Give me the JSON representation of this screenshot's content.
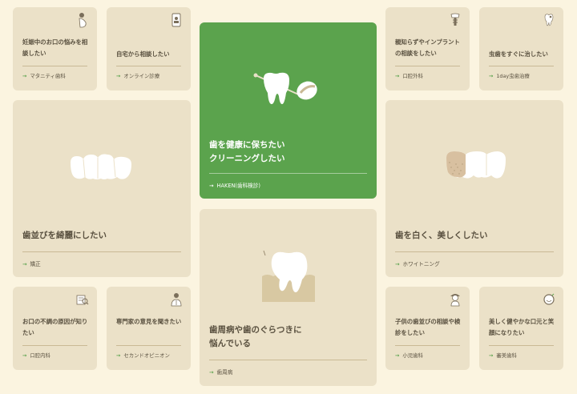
{
  "colors": {
    "background": "#fbf4e0",
    "card": "#ebe1c8",
    "accent": "#5ba34d",
    "text": "#5a5140"
  },
  "cards": {
    "maternity": {
      "title": "妊娠中のお口の悩みを相談したい",
      "link": "マタニティ歯科",
      "icon": "pregnant-person-icon"
    },
    "online": {
      "title": "自宅から相談したい",
      "link": "オンライン診療",
      "icon": "smartphone-icon"
    },
    "cleaning": {
      "title": "歯を健康に保ちたい\nクリーニングしたい",
      "link": "HAKEN(歯科検診)",
      "icon": "tooth-cleaning-icon"
    },
    "wisdom": {
      "title": "親知らずやインプラントの相談をしたい",
      "link": "口腔外科",
      "icon": "implant-icon"
    },
    "cavity": {
      "title": "虫歯をすぐに治したい",
      "link": "1day虫歯治療",
      "icon": "decayed-tooth-icon"
    },
    "alignment": {
      "title": "歯並びを綺麗にしたい",
      "link": "矯正",
      "icon": "teeth-row-icon"
    },
    "perio": {
      "title": "歯周病や歯のぐらつきに\n悩んでいる",
      "link": "歯周病",
      "icon": "loose-tooth-icon"
    },
    "whitening": {
      "title": "歯を白く、美しくしたい",
      "link": "ホワイトニング",
      "icon": "whitening-teeth-icon"
    },
    "bad_breath": {
      "title": "お口の不調の原因が知りたい",
      "link": "口腔内科",
      "icon": "magnifier-document-icon"
    },
    "second": {
      "title": "専門家の意見を聞きたい",
      "link": "セカンドオピニオン",
      "icon": "doctor-icon"
    },
    "pediatric": {
      "title": "子供の歯並びの相談や検診をしたい",
      "link": "小児歯科",
      "icon": "child-icon"
    },
    "cosmetic": {
      "title": "美しく健やかな口元と笑顔になりたい",
      "link": "審美歯科",
      "icon": "smile-icon"
    }
  }
}
